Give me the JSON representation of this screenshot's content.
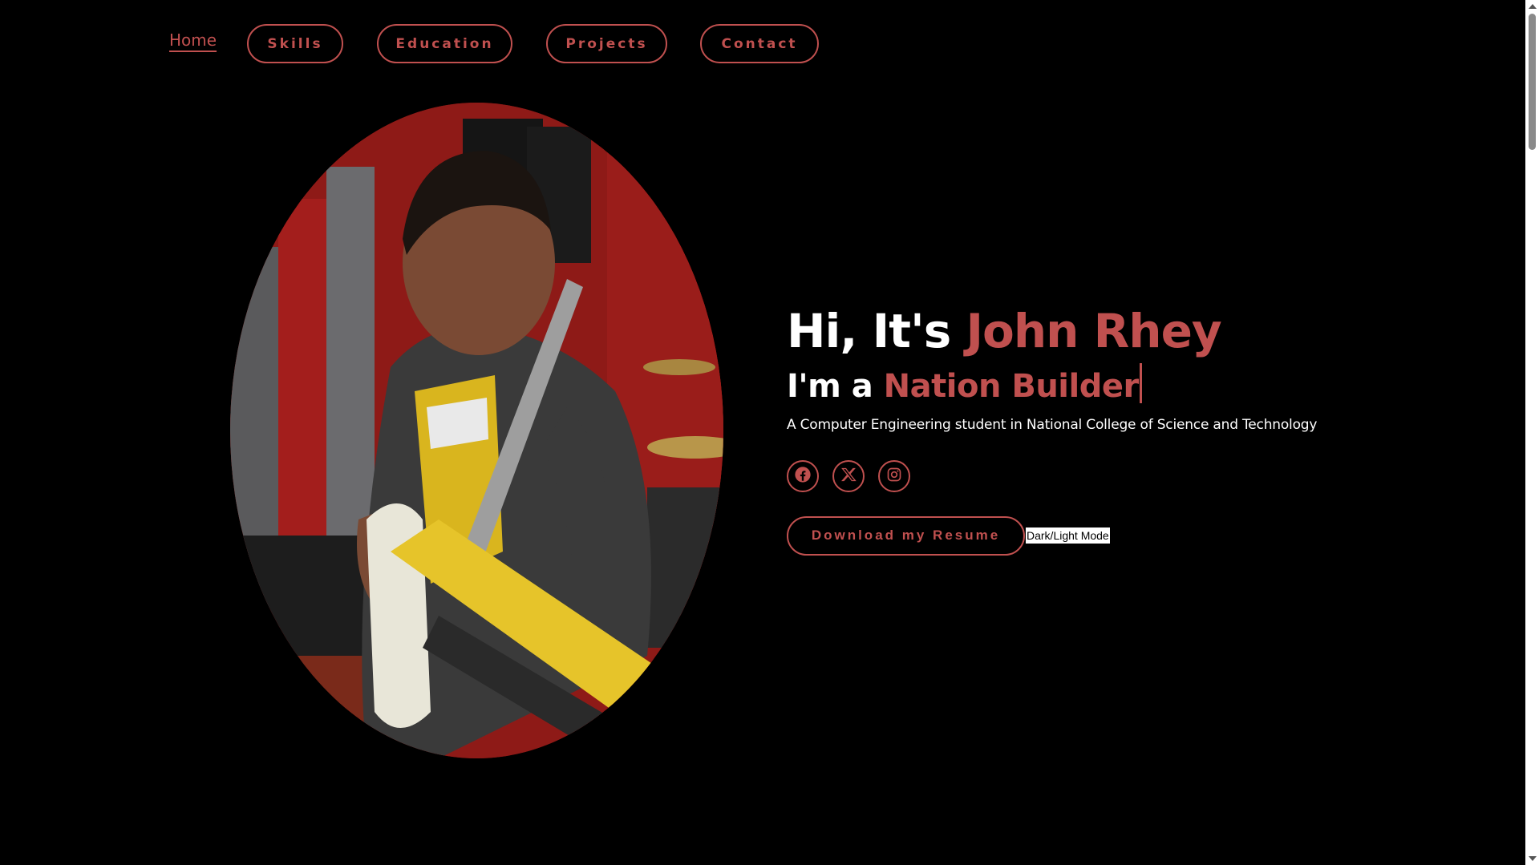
{
  "nav": {
    "home": "Home",
    "items": [
      "Skills",
      "Education",
      "Projects",
      "Contact"
    ]
  },
  "hero": {
    "greeting_prefix": "Hi, It's ",
    "name": "John Rhey",
    "role_prefix": "I'm a ",
    "role": "Nation Builder",
    "description": "A Computer Engineering student in National College of Science and Technology"
  },
  "socials": [
    {
      "icon": "facebook-icon"
    },
    {
      "icon": "x-icon"
    },
    {
      "icon": "instagram-icon"
    }
  ],
  "actions": {
    "resume_label": "Download my Resume",
    "mode_label": "Dark/Light Mode"
  },
  "theme": {
    "accent": "#c0504f",
    "background": "#000000",
    "text": "#ffffff"
  }
}
